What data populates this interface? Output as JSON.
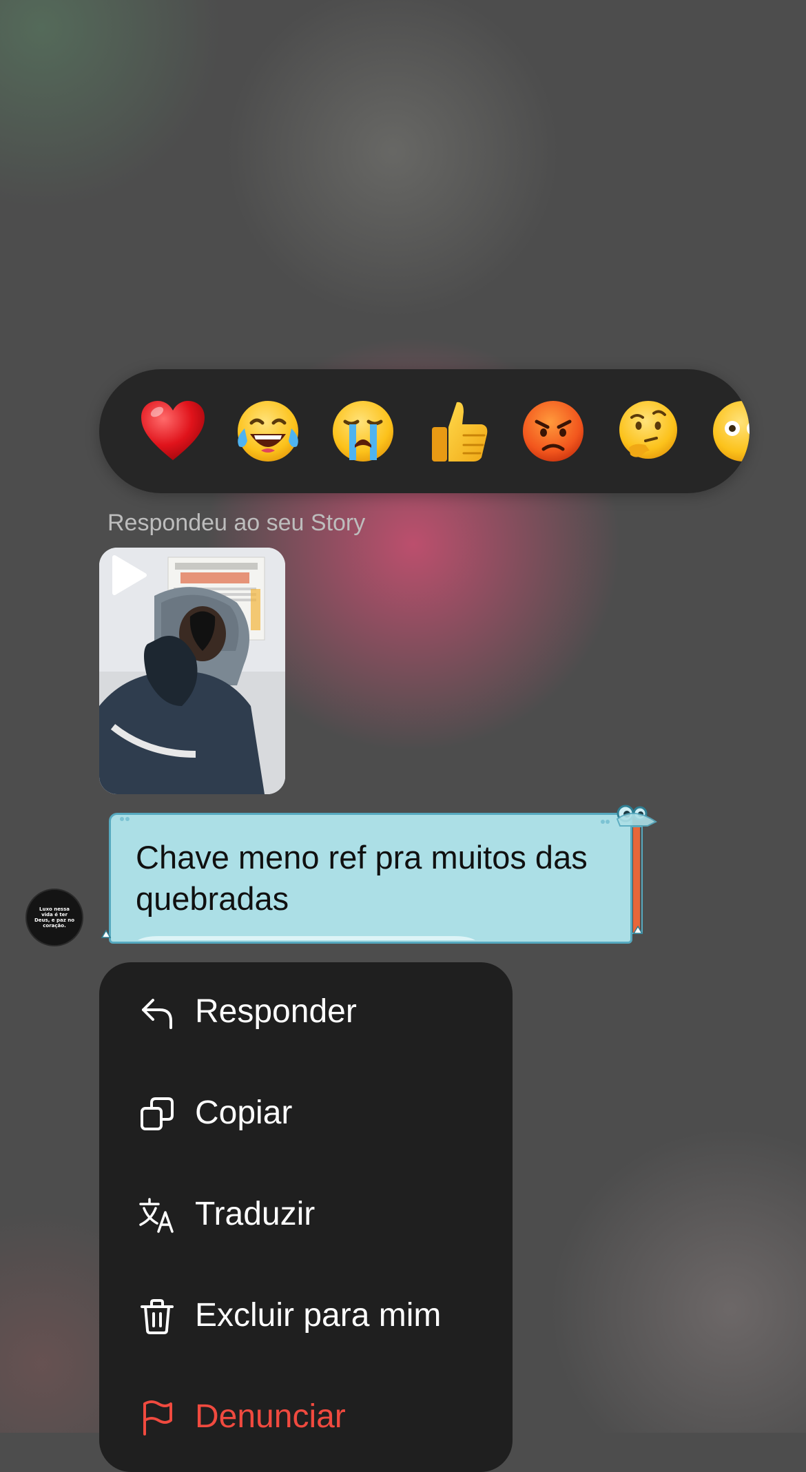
{
  "reactions": [
    {
      "name": "red-heart",
      "emoji": "❤️"
    },
    {
      "name": "tears-of-joy",
      "emoji": "😂"
    },
    {
      "name": "loudly-crying",
      "emoji": "😭"
    },
    {
      "name": "thumbs-up",
      "emoji": "👍"
    },
    {
      "name": "angry-face",
      "emoji": "😡"
    },
    {
      "name": "thinking-face",
      "emoji": "🤔"
    },
    {
      "name": "surprised-face",
      "emoji": "😳"
    }
  ],
  "story_reply": {
    "label": "Respondeu ao seu Story"
  },
  "avatar": {
    "caption": "Luxo nessa vida é ter Deus, e paz no coração."
  },
  "message": {
    "text": "Chave meno ref pra muitos das quebradas"
  },
  "menu": {
    "items": [
      {
        "label": "Responder",
        "icon": "reply-icon"
      },
      {
        "label": "Copiar",
        "icon": "copy-icon"
      },
      {
        "label": "Traduzir",
        "icon": "translate-icon"
      },
      {
        "label": "Excluir para mim",
        "icon": "trash-icon"
      },
      {
        "label": "Denunciar",
        "icon": "flag-icon"
      }
    ]
  },
  "colors": {
    "bubble": "#acdfe6",
    "bubble_border": "#56a9bf",
    "menu_bg": "#1f1f1f",
    "danger": "#f04a3f",
    "reaction_bar": "#262626"
  }
}
